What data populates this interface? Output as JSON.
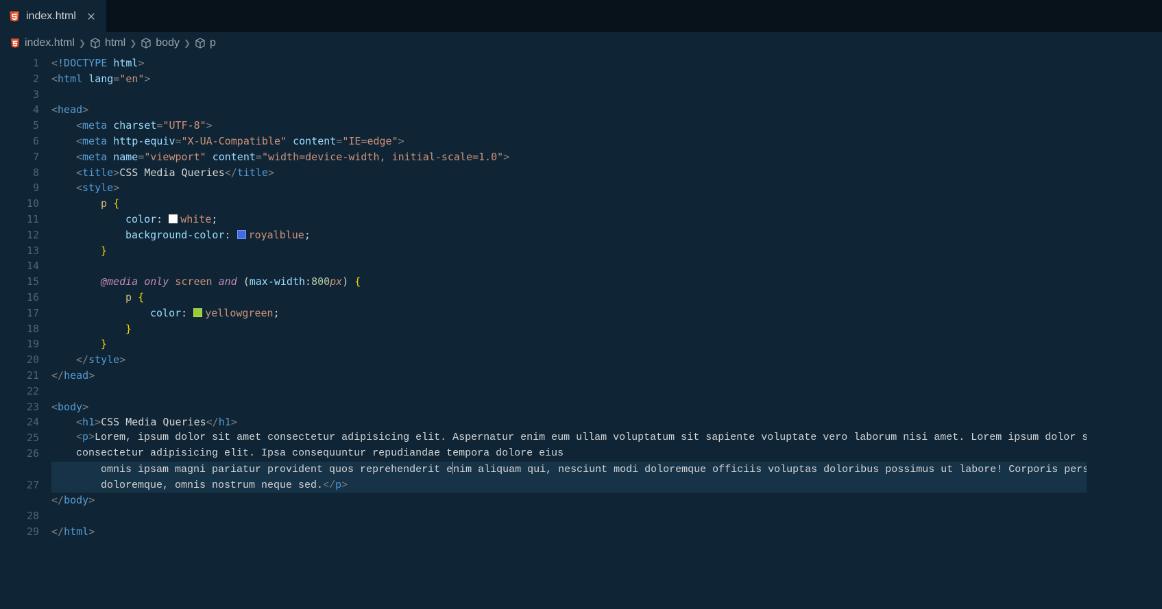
{
  "tab": {
    "label": "index.html",
    "icon": "html5"
  },
  "breadcrumbs": [
    {
      "icon": "html5",
      "label": "index.html"
    },
    {
      "icon": "cube",
      "label": "html"
    },
    {
      "icon": "cube",
      "label": "body"
    },
    {
      "icon": "cube",
      "label": "p"
    }
  ],
  "lineNumbers": [
    "1",
    "2",
    "3",
    "4",
    "5",
    "6",
    "7",
    "8",
    "9",
    "10",
    "11",
    "12",
    "13",
    "14",
    "15",
    "16",
    "17",
    "18",
    "19",
    "20",
    "21",
    "22",
    "23",
    "24",
    "25",
    "26",
    "27",
    "28",
    "29"
  ],
  "code": {
    "l1": {
      "doctype": "!DOCTYPE",
      "html": "html"
    },
    "l2": {
      "tag": "html",
      "attr": "lang",
      "val": "\"en\""
    },
    "l4": {
      "tag": "head"
    },
    "l5": {
      "tag": "meta",
      "attr1": "charset",
      "val1": "\"UTF-8\""
    },
    "l6": {
      "tag": "meta",
      "attr1": "http-equiv",
      "val1": "\"X-UA-Compatible\"",
      "attr2": "content",
      "val2": "\"IE=edge\""
    },
    "l7": {
      "tag": "meta",
      "attr1": "name",
      "val1": "\"viewport\"",
      "attr2": "content",
      "val2": "\"width=device-width, initial-scale=1.0\""
    },
    "l8": {
      "tag": "title",
      "text": "CSS Media Queries"
    },
    "l9": {
      "tag": "style"
    },
    "l10": {
      "sel": "p"
    },
    "l11": {
      "prop": "color",
      "val": "white",
      "swatch": "white"
    },
    "l12": {
      "prop": "background-color",
      "val": "royalblue",
      "swatch": "royalblue"
    },
    "l15": {
      "media": "@media",
      "only": "only",
      "screen": "screen",
      "and": "and",
      "maxw": "max-width",
      "num": "800",
      "unit": "px"
    },
    "l16": {
      "sel": "p"
    },
    "l17": {
      "prop": "color",
      "val": "yellowgreen",
      "swatch": "yellowgreen"
    },
    "l20": {
      "tag": "style"
    },
    "l21": {
      "tag": "head"
    },
    "l23": {
      "tag": "body"
    },
    "l24": {
      "tag": "h1",
      "text": "CSS Media Queries"
    },
    "l25": {
      "tag": "p",
      "text": "Lorem, ipsum dolor sit amet consectetur adipisicing elit. Aspernatur enim eum ullam voluptatum sit sapiente voluptate vero laborum nisi amet. Lorem ipsum dolor sit amet consectetur adipisicing elit. Ipsa consequuntur repudiandae tempora dolore eius"
    },
    "l26": {
      "text1": "omnis ipsam magni pariatur provident quos reprehenderit e",
      "text2": "nim aliquam qui, nesciunt modi doloremque officiis voluptas doloribus possimus ut labore! Corporis perspiciatis doloremque, omnis nostrum neque sed.",
      "tag": "p"
    },
    "l27": {
      "tag": "body"
    },
    "l29": {
      "tag": "html"
    }
  }
}
